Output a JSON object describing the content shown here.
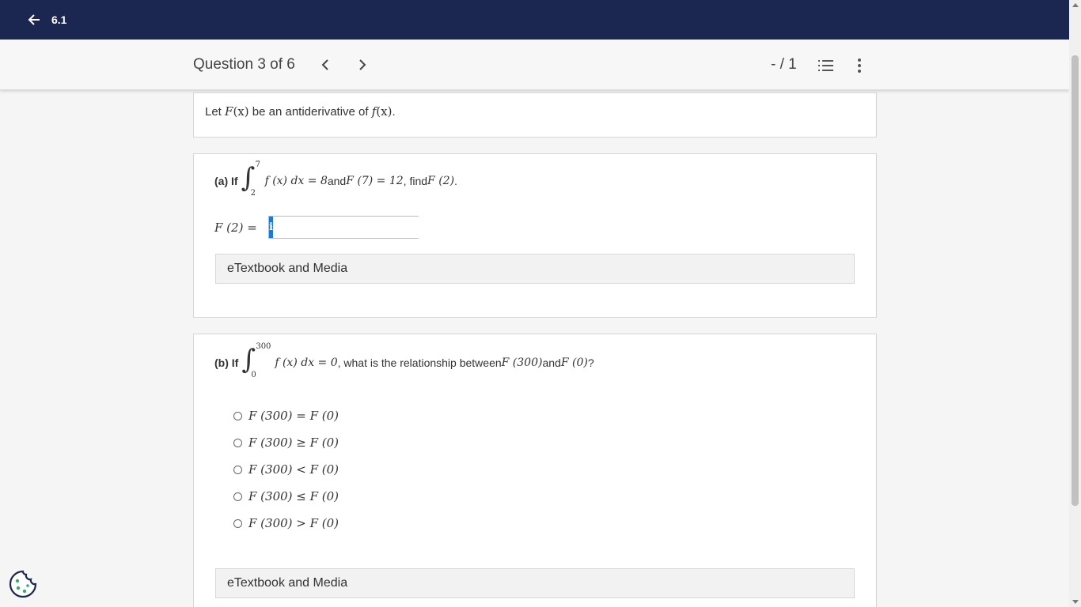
{
  "topbar": {
    "title": "6.1"
  },
  "question_bar": {
    "title": "Question 3 of 6",
    "score": "- / 1"
  },
  "intro": {
    "pre": "Let ",
    "F": "F",
    "paren_x": "(x)",
    "mid": " be an antiderivative of ",
    "f": "f",
    "paren_x2": "(x)",
    "end": "."
  },
  "part_a": {
    "label": "(a) If",
    "int_upper": "7",
    "int_lower": "2",
    "integrand": "f (x) dx = 8",
    "and": " and ",
    "cond": "F (7) = 12",
    "find": ", find ",
    "target": "F (2)",
    "end": ".",
    "answer_label": "F (2) =",
    "info_icon": "i",
    "answer_value": "",
    "etext_label": "eTextbook and Media"
  },
  "part_b": {
    "label": "(b) If",
    "int_upper": "300",
    "int_lower": "0",
    "integrand": "f (x) dx = 0",
    "question": ", what is the relationship between ",
    "a": "F (300)",
    "and": " and ",
    "b": "F (0)",
    "end": "?",
    "options": [
      "F (300) = F (0)",
      "F (300) ≥ F (0)",
      "F (300) < F (0)",
      "F (300) ≤ F (0)",
      "F (300) > F (0)"
    ],
    "etext_label": "eTextbook and Media"
  },
  "icons": {
    "back": "arrow-left-icon",
    "prev": "chevron-left-icon",
    "next": "chevron-right-icon",
    "list": "numbered-list-icon",
    "more": "more-vertical-icon",
    "cookie": "cookie-icon"
  },
  "colors": {
    "topbar": "#1b2750",
    "info_button": "#1a7bd6"
  }
}
